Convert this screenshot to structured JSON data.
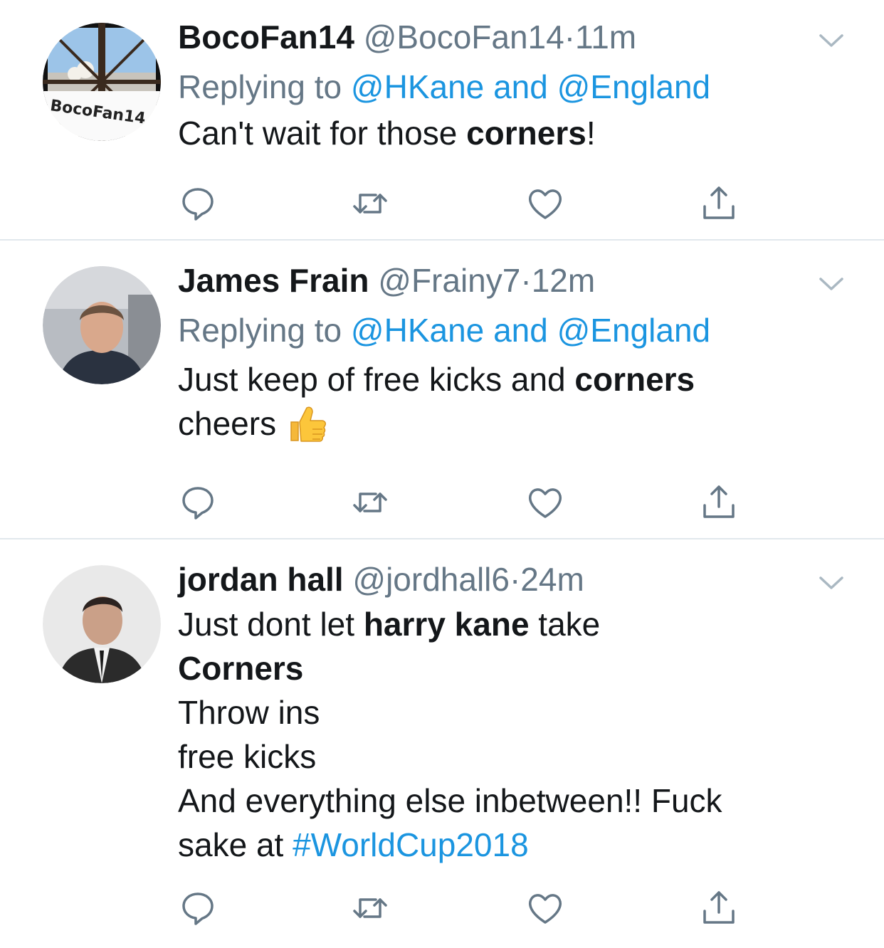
{
  "colors": {
    "link": "#1b95e0",
    "muted": "#657786",
    "text": "#14171a",
    "divider": "#e1e8ed"
  },
  "icons": [
    "chevron-down-icon",
    "reply-icon",
    "retweet-icon",
    "like-icon",
    "share-icon",
    "thumbs-up-emoji"
  ],
  "tweets": [
    {
      "name": "BocoFan14",
      "handle": "@BocoFan14",
      "sep": "·",
      "time": "11m",
      "replying_prefix": "Replying to",
      "reply_to_1": "@HKane",
      "reply_and": "and",
      "reply_to_2": "@England",
      "text_1": "Can't wait for those ",
      "text_bold": "corners",
      "text_2": "!",
      "avatar_text": "BocoFan14"
    },
    {
      "name": "James Frain",
      "handle": "@Frainy7",
      "sep": "·",
      "time": "12m",
      "replying_prefix": "Replying to",
      "reply_to_1": "@HKane",
      "reply_and": "and",
      "reply_to_2": "@England",
      "text_1": "Just keep of free kicks and ",
      "text_bold": "corners",
      "text_2": "cheers"
    },
    {
      "name": "jordan hall",
      "handle": "@jordhall6",
      "sep": "·",
      "time": "24m",
      "line1_a": "Just dont let ",
      "line1_bold": "harry kane",
      "line1_b": " take",
      "line2_bold": "Corners",
      "line3": "Throw ins",
      "line4": "free kicks",
      "line5": "And everything else inbetween!! Fuck",
      "line6_a": "sake at ",
      "hashtag": "#WorldCup2018"
    }
  ]
}
